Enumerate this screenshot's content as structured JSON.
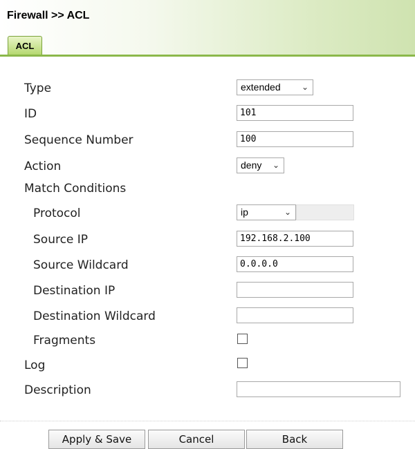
{
  "page": {
    "title": "Firewall >> ACL"
  },
  "tabs": [
    {
      "label": "ACL",
      "active": true
    }
  ],
  "form": {
    "type": {
      "label": "Type",
      "value": "extended"
    },
    "id": {
      "label": "ID",
      "value": "101"
    },
    "sequence": {
      "label": "Sequence Number",
      "value": "100"
    },
    "action": {
      "label": "Action",
      "value": "deny"
    },
    "match": {
      "label": "Match Conditions"
    },
    "protocol": {
      "label": "Protocol",
      "value": "ip",
      "extra_value": ""
    },
    "source_ip": {
      "label": "Source IP",
      "value": "192.168.2.100"
    },
    "source_wild": {
      "label": "Source Wildcard",
      "value": "0.0.0.0"
    },
    "dest_ip": {
      "label": "Destination IP",
      "value": ""
    },
    "dest_wild": {
      "label": "Destination Wildcard",
      "value": ""
    },
    "fragments": {
      "label": "Fragments",
      "checked": false
    },
    "log": {
      "label": "Log",
      "checked": false
    },
    "description": {
      "label": "Description",
      "value": ""
    }
  },
  "buttons": {
    "apply": "Apply & Save",
    "cancel": "Cancel",
    "back": "Back"
  },
  "icons": {
    "dropdown": "chevron-down-icon"
  },
  "colors": {
    "accent_green": "#8bb84a",
    "header_gradient_end": "#cfe3b0"
  }
}
